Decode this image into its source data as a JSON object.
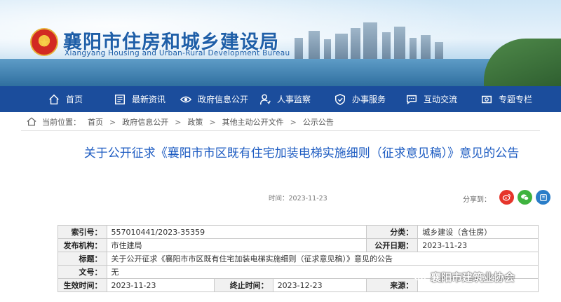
{
  "header": {
    "title": "襄阳市住房和城乡建设局",
    "subtitle": "Xiangyang Housing and Urban-Rural Development Bureau"
  },
  "nav": {
    "items": [
      {
        "label": "首页",
        "icon": "home-icon"
      },
      {
        "label": "最新资讯",
        "icon": "news-icon"
      },
      {
        "label": "政府信息公开",
        "icon": "eye-icon"
      },
      {
        "label": "人事监察",
        "icon": "person-icon"
      },
      {
        "label": "办事服务",
        "icon": "shield-icon"
      },
      {
        "label": "互动交流",
        "icon": "chat-icon"
      },
      {
        "label": "专题专栏",
        "icon": "column-icon"
      }
    ]
  },
  "breadcrumb": {
    "prefix": "当前位置：",
    "items": [
      "首页",
      "政府信息公开",
      "政策",
      "其他主动公开文件",
      "公示公告"
    ]
  },
  "article": {
    "title": "关于公开征求《襄阳市市区既有住宅加装电梯实施细则（征求意见稿）》意见的公告",
    "time": "时间：2023-11-23",
    "share_label": "分享到："
  },
  "info_table": {
    "index_label": "索引号：",
    "index_value": "557010441/2023-35359",
    "category_label": "分类：",
    "category_value": "城乡建设（含住房）",
    "org_label": "发布机构：",
    "org_value": "市住建局",
    "pubdate_label": "公开日期：",
    "pubdate_value": "2023-11-23",
    "title_label": "标题：",
    "title_value": "关于公开征求《襄阳市市区既有住宅加装电梯实施细则（征求意见稿）》意见的公告",
    "docno_label": "文号：",
    "docno_value": "无",
    "effective_label": "生效时间：",
    "effective_value": "2023-11-23",
    "end_label": "终止时间：",
    "end_value": "2023-12-23",
    "source_label": "来源：",
    "source_value": ""
  },
  "watermark": {
    "text": "襄阳市建筑业协会"
  },
  "colors": {
    "nav_bg": "#1b4d9c",
    "title_blue": "#1e5cc2",
    "weibo": "#e6352b",
    "wechat": "#3fb33f",
    "other": "#2a7dc8"
  }
}
